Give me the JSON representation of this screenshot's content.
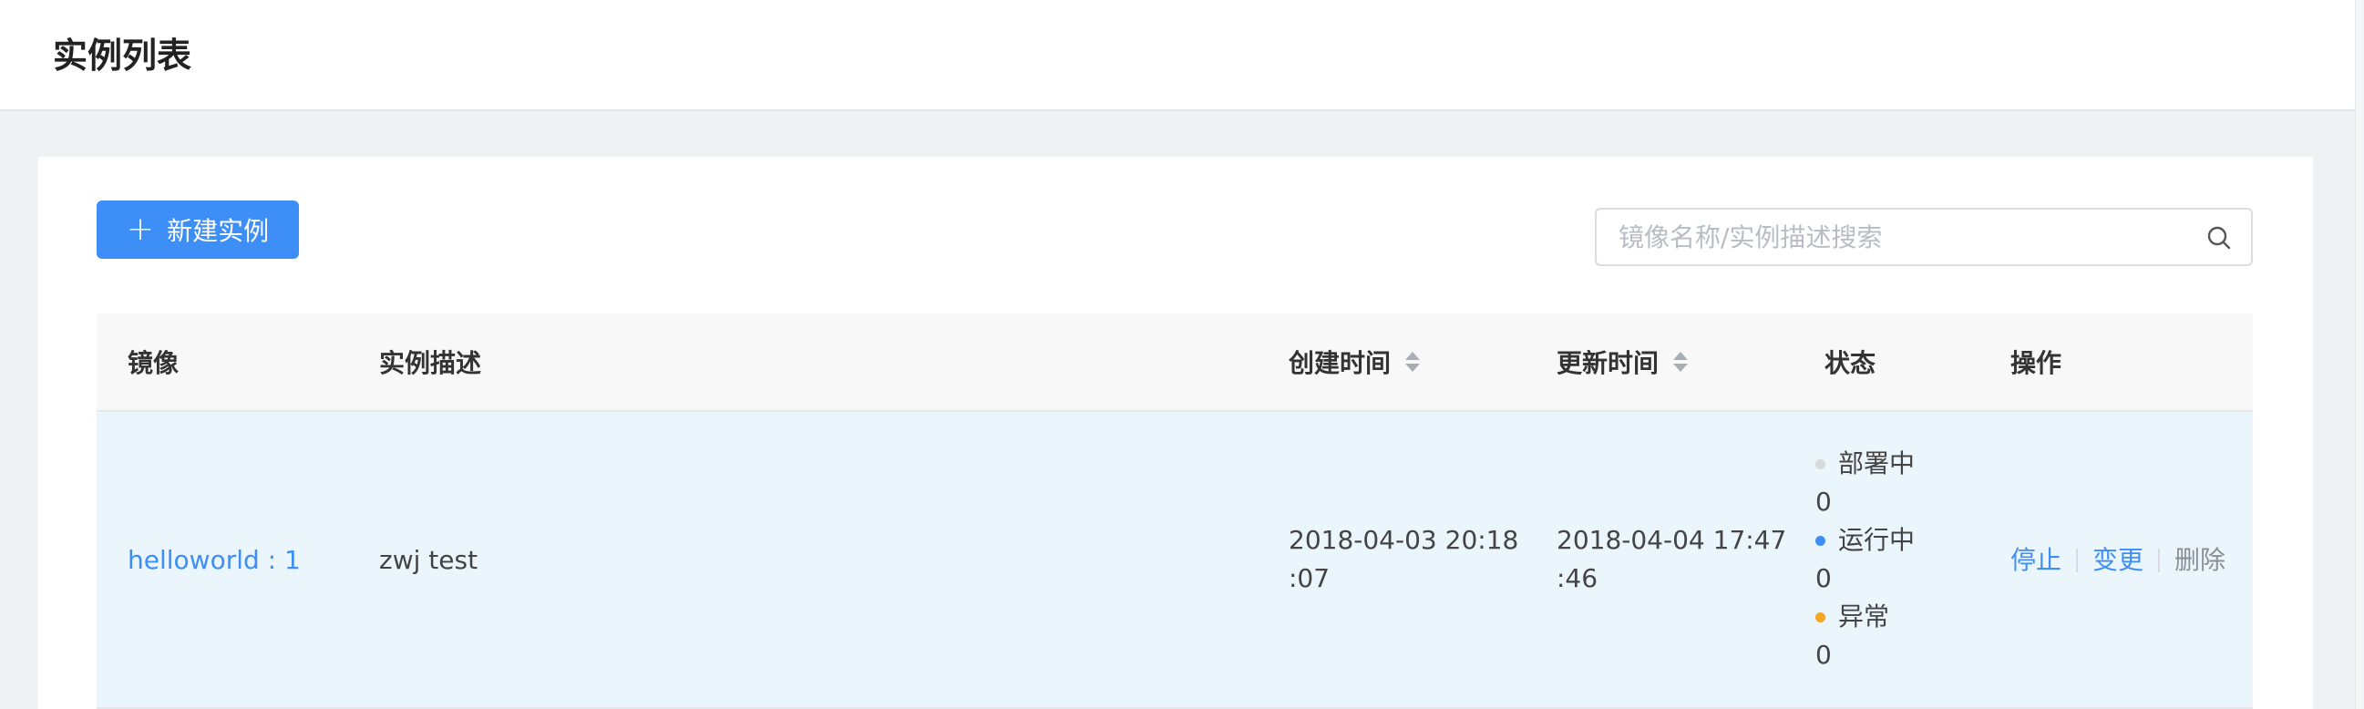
{
  "header": {
    "title": "实例列表"
  },
  "toolbar": {
    "new_button_label": "新建实例",
    "search_placeholder": "镜像名称/实例描述搜索",
    "search_value": ""
  },
  "table": {
    "columns": {
      "image": "镜像",
      "description": "实例描述",
      "created": "创建时间",
      "updated": "更新时间",
      "status": "状态",
      "actions": "操作"
    },
    "rows": [
      {
        "image": "helloworld : 1",
        "description": "zwj test",
        "created_line1": "2018-04-03 20:18",
        "created_line2": ":07",
        "updated_line1": "2018-04-04 17:47",
        "updated_line2": ":46",
        "status": [
          {
            "label": "部署中",
            "count": "0",
            "color": "#d9d9d9"
          },
          {
            "label": "运行中",
            "count": "0",
            "color": "#3e8ef7"
          },
          {
            "label": "异常",
            "count": "0",
            "color": "#f5a623"
          }
        ],
        "actions": {
          "stop": "停止",
          "change": "变更",
          "delete": "删除"
        }
      }
    ]
  },
  "colors": {
    "primary": "#3e8ef7",
    "row_highlight": "#ebf5fc",
    "page_bg": "#eff1f4"
  }
}
